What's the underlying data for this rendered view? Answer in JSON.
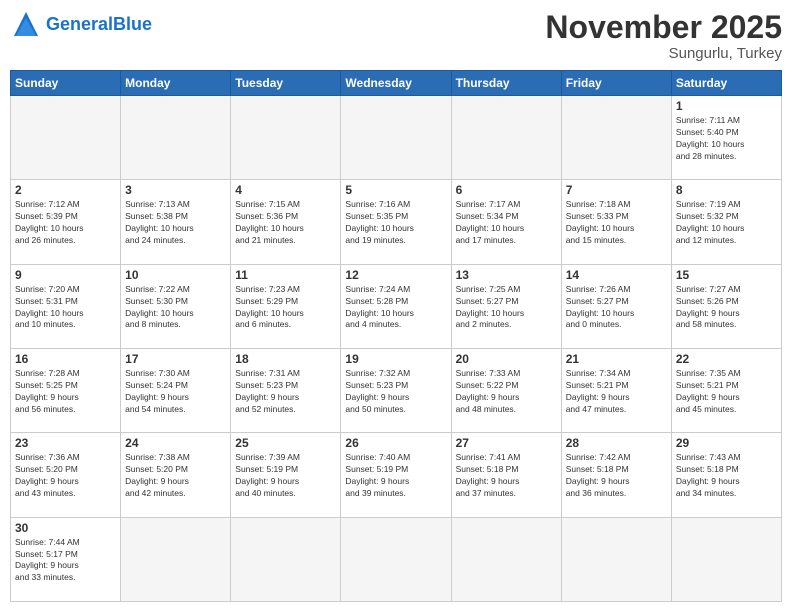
{
  "header": {
    "logo_general": "General",
    "logo_blue": "Blue",
    "month_title": "November 2025",
    "subtitle": "Sungurlu, Turkey"
  },
  "weekdays": [
    "Sunday",
    "Monday",
    "Tuesday",
    "Wednesday",
    "Thursday",
    "Friday",
    "Saturday"
  ],
  "days": [
    {
      "day": "",
      "info": ""
    },
    {
      "day": "",
      "info": ""
    },
    {
      "day": "",
      "info": ""
    },
    {
      "day": "",
      "info": ""
    },
    {
      "day": "",
      "info": ""
    },
    {
      "day": "",
      "info": ""
    },
    {
      "day": "1",
      "info": "Sunrise: 7:11 AM\nSunset: 5:40 PM\nDaylight: 10 hours\nand 28 minutes."
    },
    {
      "day": "2",
      "info": "Sunrise: 7:12 AM\nSunset: 5:39 PM\nDaylight: 10 hours\nand 26 minutes."
    },
    {
      "day": "3",
      "info": "Sunrise: 7:13 AM\nSunset: 5:38 PM\nDaylight: 10 hours\nand 24 minutes."
    },
    {
      "day": "4",
      "info": "Sunrise: 7:15 AM\nSunset: 5:36 PM\nDaylight: 10 hours\nand 21 minutes."
    },
    {
      "day": "5",
      "info": "Sunrise: 7:16 AM\nSunset: 5:35 PM\nDaylight: 10 hours\nand 19 minutes."
    },
    {
      "day": "6",
      "info": "Sunrise: 7:17 AM\nSunset: 5:34 PM\nDaylight: 10 hours\nand 17 minutes."
    },
    {
      "day": "7",
      "info": "Sunrise: 7:18 AM\nSunset: 5:33 PM\nDaylight: 10 hours\nand 15 minutes."
    },
    {
      "day": "8",
      "info": "Sunrise: 7:19 AM\nSunset: 5:32 PM\nDaylight: 10 hours\nand 12 minutes."
    },
    {
      "day": "9",
      "info": "Sunrise: 7:20 AM\nSunset: 5:31 PM\nDaylight: 10 hours\nand 10 minutes."
    },
    {
      "day": "10",
      "info": "Sunrise: 7:22 AM\nSunset: 5:30 PM\nDaylight: 10 hours\nand 8 minutes."
    },
    {
      "day": "11",
      "info": "Sunrise: 7:23 AM\nSunset: 5:29 PM\nDaylight: 10 hours\nand 6 minutes."
    },
    {
      "day": "12",
      "info": "Sunrise: 7:24 AM\nSunset: 5:28 PM\nDaylight: 10 hours\nand 4 minutes."
    },
    {
      "day": "13",
      "info": "Sunrise: 7:25 AM\nSunset: 5:27 PM\nDaylight: 10 hours\nand 2 minutes."
    },
    {
      "day": "14",
      "info": "Sunrise: 7:26 AM\nSunset: 5:27 PM\nDaylight: 10 hours\nand 0 minutes."
    },
    {
      "day": "15",
      "info": "Sunrise: 7:27 AM\nSunset: 5:26 PM\nDaylight: 9 hours\nand 58 minutes."
    },
    {
      "day": "16",
      "info": "Sunrise: 7:28 AM\nSunset: 5:25 PM\nDaylight: 9 hours\nand 56 minutes."
    },
    {
      "day": "17",
      "info": "Sunrise: 7:30 AM\nSunset: 5:24 PM\nDaylight: 9 hours\nand 54 minutes."
    },
    {
      "day": "18",
      "info": "Sunrise: 7:31 AM\nSunset: 5:23 PM\nDaylight: 9 hours\nand 52 minutes."
    },
    {
      "day": "19",
      "info": "Sunrise: 7:32 AM\nSunset: 5:23 PM\nDaylight: 9 hours\nand 50 minutes."
    },
    {
      "day": "20",
      "info": "Sunrise: 7:33 AM\nSunset: 5:22 PM\nDaylight: 9 hours\nand 48 minutes."
    },
    {
      "day": "21",
      "info": "Sunrise: 7:34 AM\nSunset: 5:21 PM\nDaylight: 9 hours\nand 47 minutes."
    },
    {
      "day": "22",
      "info": "Sunrise: 7:35 AM\nSunset: 5:21 PM\nDaylight: 9 hours\nand 45 minutes."
    },
    {
      "day": "23",
      "info": "Sunrise: 7:36 AM\nSunset: 5:20 PM\nDaylight: 9 hours\nand 43 minutes."
    },
    {
      "day": "24",
      "info": "Sunrise: 7:38 AM\nSunset: 5:20 PM\nDaylight: 9 hours\nand 42 minutes."
    },
    {
      "day": "25",
      "info": "Sunrise: 7:39 AM\nSunset: 5:19 PM\nDaylight: 9 hours\nand 40 minutes."
    },
    {
      "day": "26",
      "info": "Sunrise: 7:40 AM\nSunset: 5:19 PM\nDaylight: 9 hours\nand 39 minutes."
    },
    {
      "day": "27",
      "info": "Sunrise: 7:41 AM\nSunset: 5:18 PM\nDaylight: 9 hours\nand 37 minutes."
    },
    {
      "day": "28",
      "info": "Sunrise: 7:42 AM\nSunset: 5:18 PM\nDaylight: 9 hours\nand 36 minutes."
    },
    {
      "day": "29",
      "info": "Sunrise: 7:43 AM\nSunset: 5:18 PM\nDaylight: 9 hours\nand 34 minutes."
    },
    {
      "day": "30",
      "info": "Sunrise: 7:44 AM\nSunset: 5:17 PM\nDaylight: 9 hours\nand 33 minutes."
    },
    {
      "day": "",
      "info": ""
    },
    {
      "day": "",
      "info": ""
    },
    {
      "day": "",
      "info": ""
    },
    {
      "day": "",
      "info": ""
    },
    {
      "day": "",
      "info": ""
    },
    {
      "day": "",
      "info": ""
    }
  ]
}
